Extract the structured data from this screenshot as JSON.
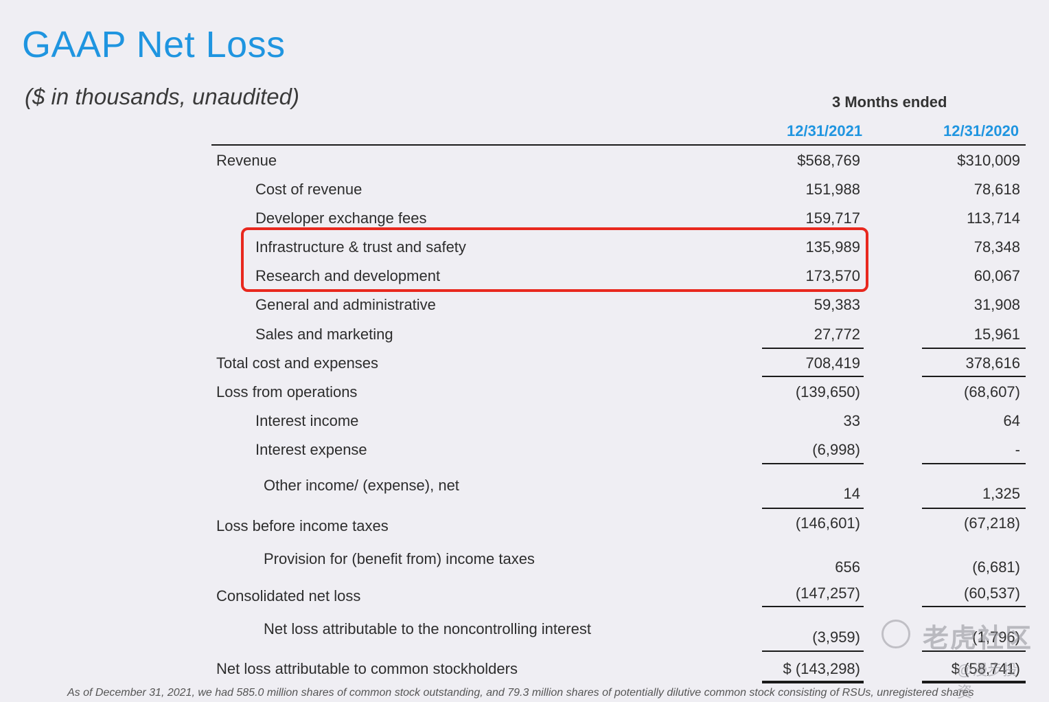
{
  "title": "GAAP Net Loss",
  "subtitle": "($ in thousands,  unaudited)",
  "period_header": "3 Months ended",
  "columns": [
    "12/31/2021",
    "12/31/2020"
  ],
  "rows": [
    {
      "label": "Revenue",
      "v1": "$568,769",
      "v2": "$310,009"
    },
    {
      "label": "Cost of revenue",
      "v1": "151,988",
      "v2": "78,618"
    },
    {
      "label": "Developer exchange fees",
      "v1": "159,717",
      "v2": "113,714"
    },
    {
      "label": "Infrastructure & trust and safety",
      "v1": "135,989",
      "v2": "78,348"
    },
    {
      "label": "Research and development",
      "v1": "173,570",
      "v2": "60,067"
    },
    {
      "label": "General and administrative",
      "v1": "59,383",
      "v2": "31,908"
    },
    {
      "label": "Sales and marketing",
      "v1": "27,772",
      "v2": "15,961"
    },
    {
      "label": "Total cost and expenses",
      "v1": "708,419",
      "v2": "378,616"
    },
    {
      "label": "Loss from operations",
      "v1": "(139,650)",
      "v2": "(68,607)"
    },
    {
      "label": "Interest income",
      "v1": "33",
      "v2": "64"
    },
    {
      "label": "Interest expense",
      "v1": "(6,998)",
      "v2": "-"
    },
    {
      "label": "Other income/ (expense), net",
      "v1": "14",
      "v2": "1,325"
    },
    {
      "label": "Loss before income taxes",
      "v1": "(146,601)",
      "v2": "(67,218)"
    },
    {
      "label": "Provision for (benefit from) income taxes",
      "v1": "656",
      "v2": "(6,681)"
    },
    {
      "label": "Consolidated net loss",
      "v1": "(147,257)",
      "v2": "(60,537)"
    },
    {
      "label": "Net loss attributable to the noncontrolling interest",
      "v1": "(3,959)",
      "v2": "(1,796)"
    },
    {
      "label": "Net loss attributable to common stockholders",
      "v1": "$ (143,298)",
      "v2": "$ (58,741)"
    }
  ],
  "footnote": "As of December 31, 2021, we had 585.0 million shares of common stock outstanding, and 79.3 million shares of potentially dilutive common stock consisting of RSUs, unregistered shares",
  "watermark": {
    "brand": "老虎社区",
    "handle": "@漫步投资"
  },
  "colors": {
    "accent": "#1f95e0",
    "highlight": "#e8281e",
    "background": "#efeef3"
  }
}
